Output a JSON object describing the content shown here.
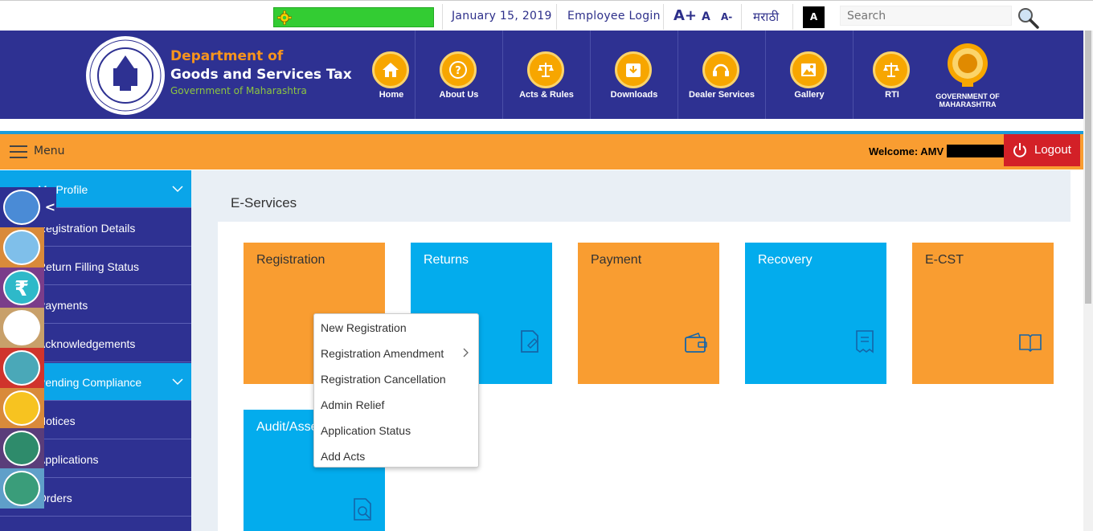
{
  "topbar": {
    "date": "January 15, 2019",
    "employee_login": "Employee Login",
    "font_increase": "A+",
    "font_normal": "A",
    "font_decrease": "A-",
    "language": "मराठी",
    "contrast": "A",
    "search_placeholder": "Search"
  },
  "header": {
    "brand_line1": "Department of",
    "brand_line2": "Goods and Services Tax",
    "brand_line3": "Government of Maharashtra",
    "nav": [
      {
        "label": "Home",
        "icon": "home-icon"
      },
      {
        "label": "About Us",
        "icon": "question-icon"
      },
      {
        "label": "Acts & Rules",
        "icon": "scales-icon"
      },
      {
        "label": "Downloads",
        "icon": "download-icon"
      },
      {
        "label": "Dealer Services",
        "icon": "headset-icon"
      },
      {
        "label": "Gallery",
        "icon": "gallery-icon"
      },
      {
        "label": "RTI",
        "icon": "scales-icon"
      }
    ],
    "gov_label": "GOVERNMENT OF MAHARASHTRA"
  },
  "menubar": {
    "menu_label": "Menu",
    "welcome": "Welcome: AMV",
    "logout": "Logout"
  },
  "sidebar": {
    "items": [
      {
        "label": "My Profile",
        "expandable": true,
        "active": true
      },
      {
        "label": "Registration Details"
      },
      {
        "label": "Return Filling Status"
      },
      {
        "label": "Payments"
      },
      {
        "label": "Acknowledgements"
      },
      {
        "label": "Pending Compliance",
        "expandable": true,
        "active": true
      },
      {
        "label": "Notices"
      },
      {
        "label": "Applications"
      },
      {
        "label": "Orders"
      }
    ]
  },
  "main": {
    "title": "E-Services",
    "tiles": [
      {
        "title": "Registration",
        "color": "#f99d31"
      },
      {
        "title": "Returns",
        "color": "#03aced"
      },
      {
        "title": "Payment",
        "color": "#f99d31"
      },
      {
        "title": "Recovery",
        "color": "#03aced"
      },
      {
        "title": "E-CST",
        "color": "#f99d31"
      },
      {
        "title": "Audit/Assessment",
        "color": "#03aced"
      }
    ]
  },
  "dropdown": {
    "items": [
      "New Registration",
      "Registration Amendment",
      "Registration Cancellation",
      "Admin Relief",
      "Application Status",
      "Add Acts"
    ]
  },
  "colors": {
    "header_blue": "#2e3192",
    "accent_orange": "#f99d31",
    "tile_blue": "#03aced",
    "logout_red": "#d32027"
  }
}
